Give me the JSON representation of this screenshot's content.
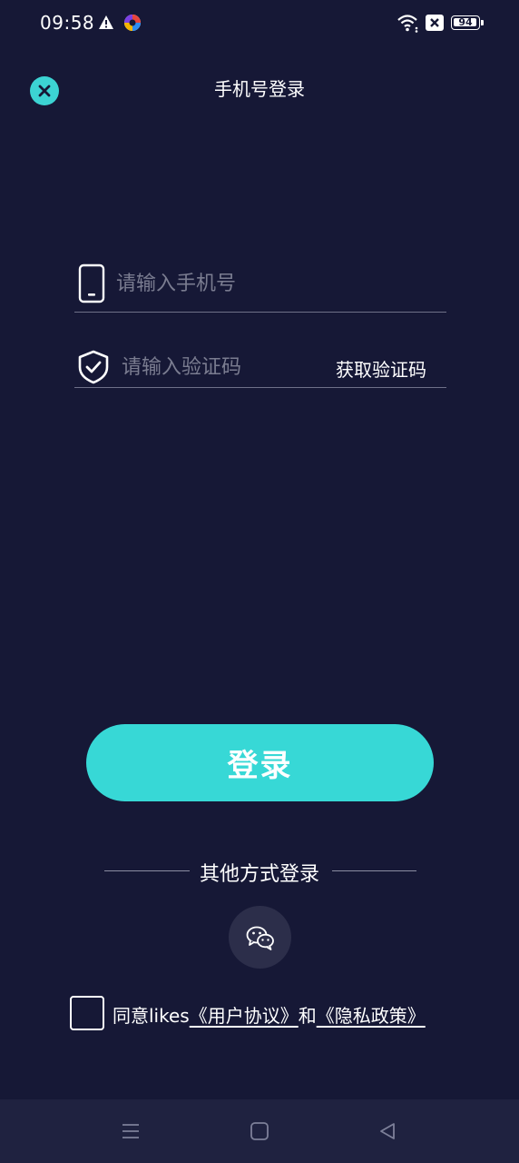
{
  "status_bar": {
    "time": "09:58",
    "battery": "94",
    "icons": [
      "warning-icon",
      "app-notification-icon",
      "wifi-icon",
      "close-box-icon",
      "battery-icon"
    ]
  },
  "header": {
    "title": "手机号登录",
    "close_icon": "close-icon"
  },
  "form": {
    "phone_placeholder": "请输入手机号",
    "phone_value": "",
    "code_placeholder": "请输入验证码",
    "code_value": "",
    "get_code_label": "获取验证码"
  },
  "login_button": "登录",
  "other_login": {
    "label": "其他方式登录",
    "wechat_icon": "wechat-icon"
  },
  "agreement": {
    "prefix": "同意likes",
    "user_agreement": "《用户协议》",
    "and": "和",
    "privacy_policy": "《隐私政策》",
    "checked": false
  },
  "colors": {
    "background": "#161836",
    "accent": "#37d8d6",
    "nav_bar": "#1f2240"
  }
}
